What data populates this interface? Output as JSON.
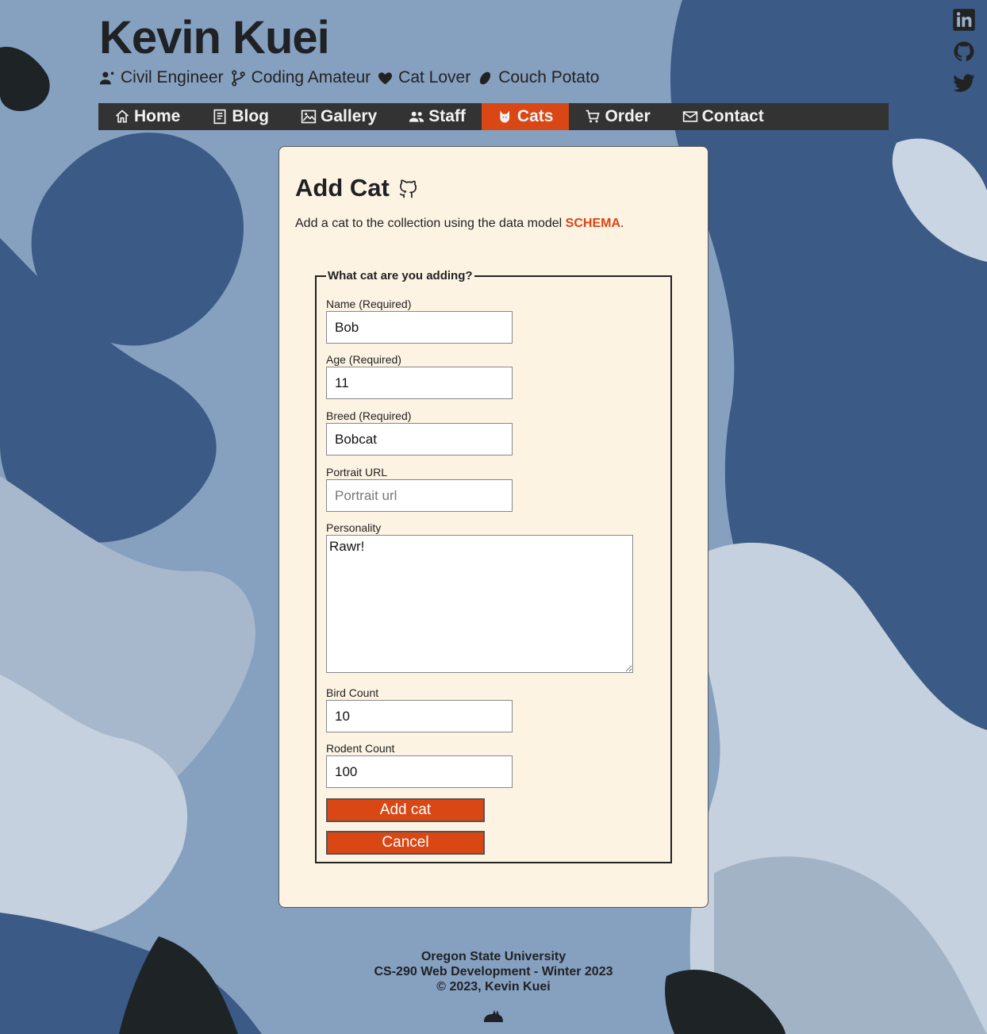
{
  "header": {
    "site_title": "Kevin Kuei",
    "taglines": [
      {
        "icon": "engineer-icon",
        "label": "Civil Engineer"
      },
      {
        "icon": "code-branch-icon",
        "label": "Coding Amateur"
      },
      {
        "icon": "cat-heart-icon",
        "label": "Cat Lover"
      },
      {
        "icon": "potato-icon",
        "label": "Couch Potato"
      }
    ],
    "social": [
      {
        "icon": "linkedin-icon"
      },
      {
        "icon": "github-icon"
      },
      {
        "icon": "twitter-icon"
      }
    ]
  },
  "nav": {
    "items": [
      {
        "icon": "home-icon",
        "label": "Home"
      },
      {
        "icon": "blog-icon",
        "label": "Blog"
      },
      {
        "icon": "gallery-icon",
        "label": "Gallery"
      },
      {
        "icon": "staff-icon",
        "label": "Staff"
      },
      {
        "icon": "cat-icon",
        "label": "Cats",
        "active": true
      },
      {
        "icon": "cart-icon",
        "label": "Order"
      },
      {
        "icon": "mail-icon",
        "label": "Contact"
      }
    ],
    "accent_color": "#d94715",
    "bar_color": "#333333"
  },
  "card": {
    "title": "Add Cat",
    "title_icon": "github-icon",
    "desc_prefix": "Add a cat to the collection using the data model ",
    "desc_link": "SCHEMA",
    "desc_suffix": ".",
    "background": "#fdf3e3"
  },
  "form": {
    "legend": "What cat are you adding?",
    "name": {
      "label": "Name (Required)",
      "value": "Bob"
    },
    "age": {
      "label": "Age (Required)",
      "value": "11"
    },
    "breed": {
      "label": "Breed (Required)",
      "value": "Bobcat"
    },
    "portrait": {
      "label": "Portrait URL",
      "value": "",
      "placeholder": "Portrait url"
    },
    "personality": {
      "label": "Personality",
      "value": "Rawr!"
    },
    "bird_count": {
      "label": "Bird Count",
      "value": "10"
    },
    "rodent_count": {
      "label": "Rodent Count",
      "value": "100"
    },
    "submit_label": "Add cat",
    "cancel_label": "Cancel"
  },
  "footer": {
    "line1": "Oregon State University",
    "line2": "CS-290 Web Development - Winter 2023",
    "line3": "© 2023, Kevin Kuei",
    "icon": "cat-icon"
  }
}
